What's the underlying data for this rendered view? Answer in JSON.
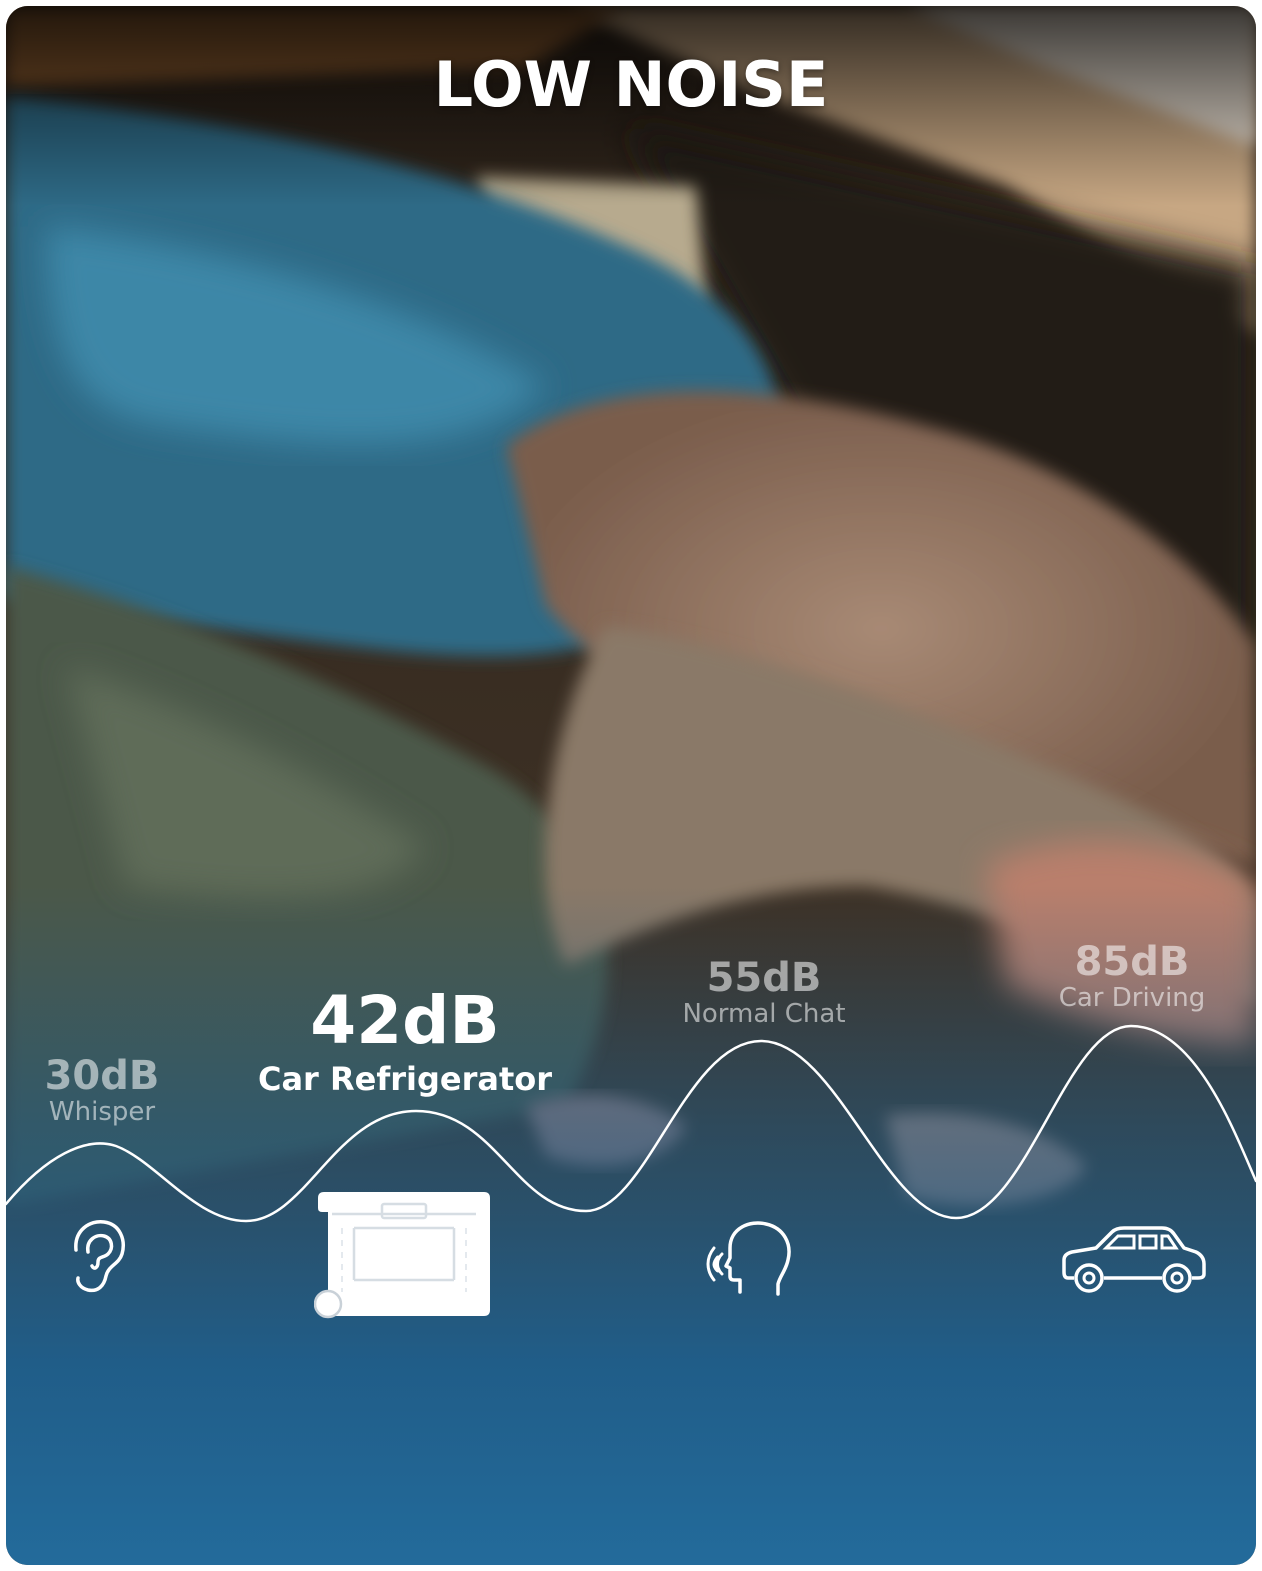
{
  "title": "LOW NOISE",
  "colors": {
    "accent": "#ffffff",
    "muted_text": "rgba(255,255,255,0.55)",
    "bottom_blue": "#1f6a9a"
  },
  "levels": [
    {
      "db": "30dB",
      "label": "Whisper",
      "icon": "ear-icon",
      "highlight": false
    },
    {
      "db": "42dB",
      "label": "Car Refrigerator",
      "icon": "refrigerator-icon",
      "highlight": true
    },
    {
      "db": "55dB",
      "label": "Normal Chat",
      "icon": "speaking-head-icon",
      "highlight": false
    },
    {
      "db": "85dB",
      "label": "Car Driving",
      "icon": "car-icon",
      "highlight": false
    }
  ]
}
